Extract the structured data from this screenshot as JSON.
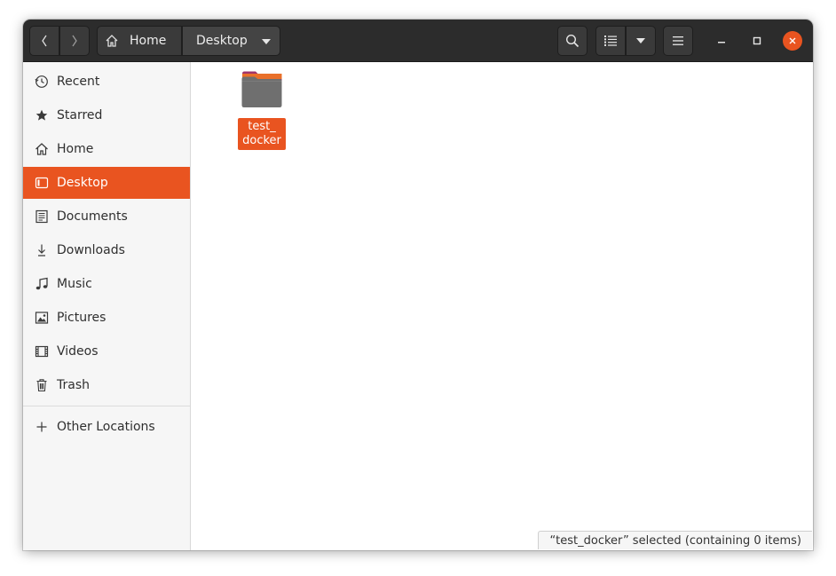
{
  "header": {
    "breadcrumb": {
      "home_label": "Home",
      "current_label": "Desktop"
    },
    "icons": {
      "back": "chevron-left-icon",
      "forward": "chevron-right-icon",
      "home": "home-icon",
      "search": "search-icon",
      "view": "list-view-icon",
      "view_menu": "caret-down-icon",
      "menu": "hamburger-menu-icon",
      "minimize": "minimize-icon",
      "maximize": "maximize-icon",
      "close": "close-icon"
    }
  },
  "sidebar": {
    "items": [
      {
        "label": "Recent",
        "icon": "clock-icon"
      },
      {
        "label": "Starred",
        "icon": "star-icon"
      },
      {
        "label": "Home",
        "icon": "home-icon"
      },
      {
        "label": "Desktop",
        "icon": "desktop-icon",
        "active": true
      },
      {
        "label": "Documents",
        "icon": "document-icon"
      },
      {
        "label": "Downloads",
        "icon": "download-icon"
      },
      {
        "label": "Music",
        "icon": "music-icon"
      },
      {
        "label": "Pictures",
        "icon": "picture-icon"
      },
      {
        "label": "Videos",
        "icon": "video-icon"
      },
      {
        "label": "Trash",
        "icon": "trash-icon"
      }
    ],
    "other_locations": {
      "label": "Other Locations",
      "icon": "plus-icon"
    }
  },
  "content": {
    "files": [
      {
        "name": "test_\ndocker",
        "type": "folder",
        "selected": true
      }
    ],
    "status_text": "“test_docker” selected  (containing 0 items)"
  },
  "colors": {
    "accent": "#e95420",
    "headerbar": "#2c2c2c",
    "sidebar_bg": "#f6f6f6",
    "folder_body": "#6f6f6f",
    "folder_tab": "#a0346a"
  }
}
